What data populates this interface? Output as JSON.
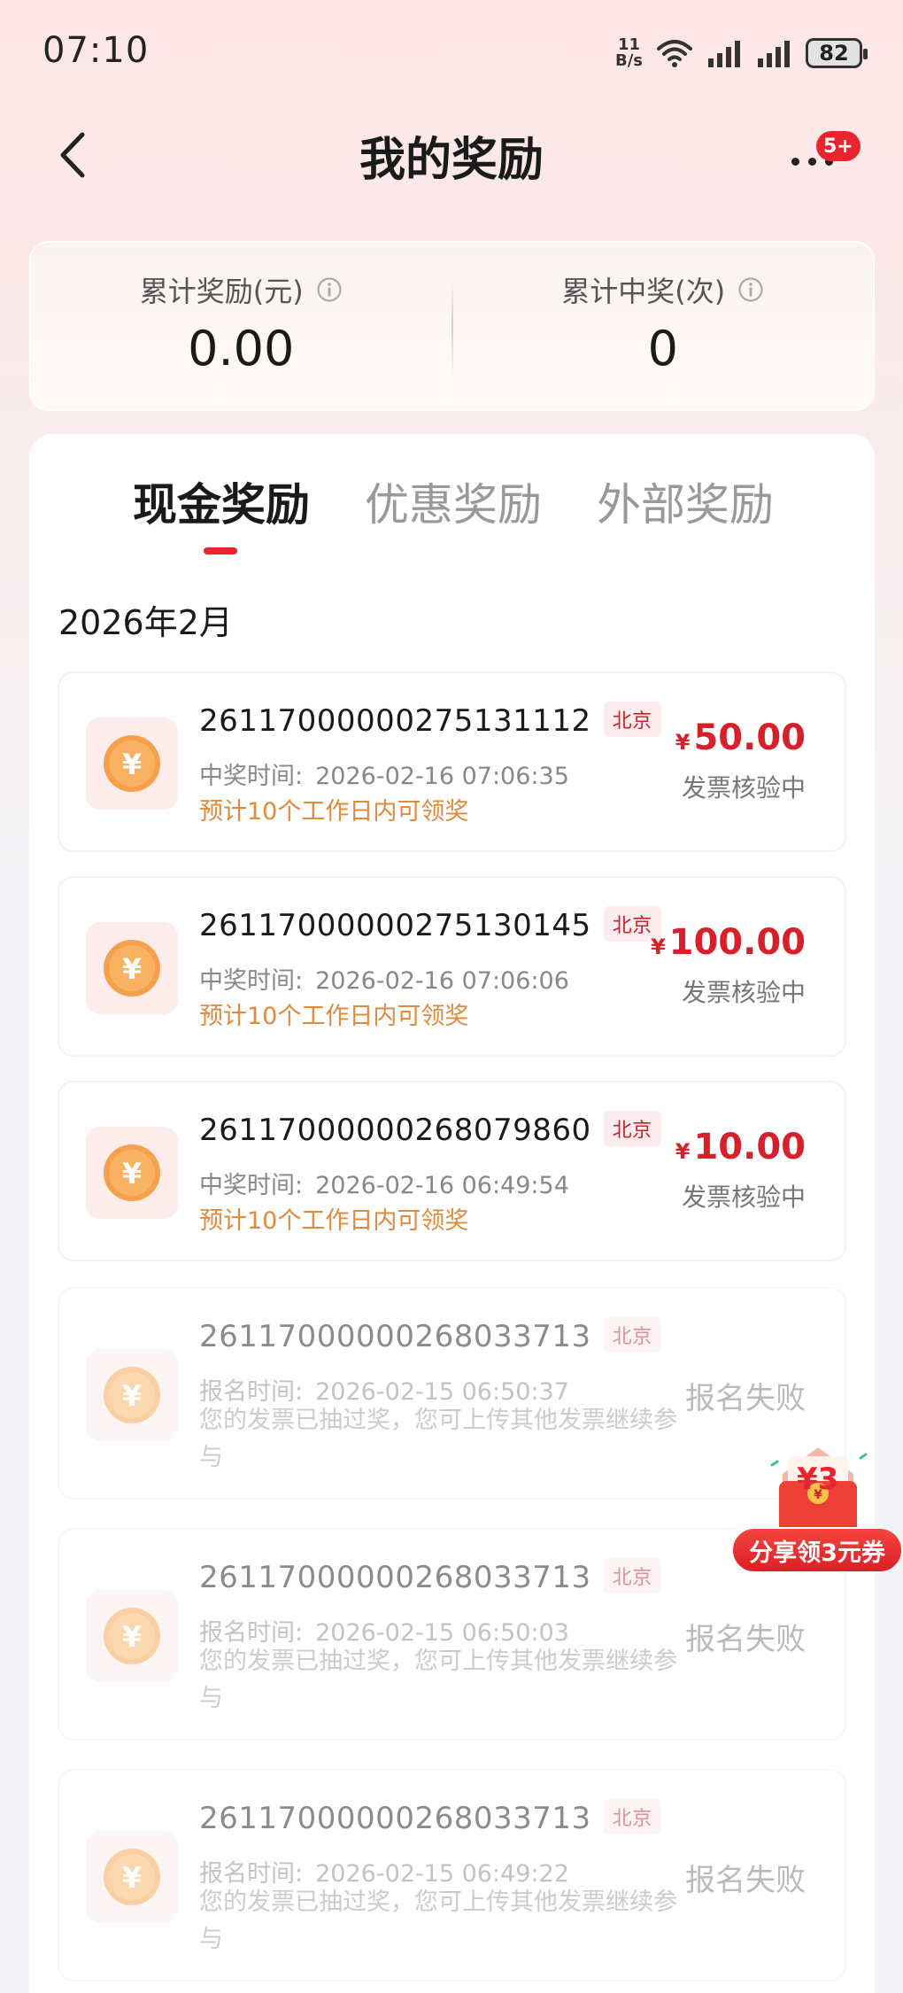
{
  "status_bar": {
    "time": "07:10",
    "net_speed_value": "11",
    "net_speed_unit": "B/s",
    "battery": "82"
  },
  "nav": {
    "title": "我的奖励",
    "more_badge": "5+"
  },
  "summary": {
    "total_reward_label": "累计奖励(元)",
    "total_reward_value": "0.00",
    "total_wins_label": "累计中奖(次)",
    "total_wins_value": "0"
  },
  "tabs": [
    {
      "label": "现金奖励",
      "active": true
    },
    {
      "label": "优惠奖励",
      "active": false
    },
    {
      "label": "外部奖励",
      "active": false
    }
  ],
  "month": "2026年2月",
  "records": [
    {
      "number": "26117000000275131112",
      "region": "北京",
      "time_label": "中奖时间:",
      "time": "2026-02-16 07:06:35",
      "note": "预计10个工作日内可领奖",
      "currency": "¥",
      "amount": "50.00",
      "status": "发票核验中"
    },
    {
      "number": "26117000000275130145",
      "region": "北京",
      "time_label": "中奖时间:",
      "time": "2026-02-16 07:06:06",
      "note": "预计10个工作日内可领奖",
      "currency": "¥",
      "amount": "100.00",
      "status": "发票核验中"
    },
    {
      "number": "26117000000268079860",
      "region": "北京",
      "time_label": "中奖时间:",
      "time": "2026-02-16 06:49:54",
      "note": "预计10个工作日内可领奖",
      "currency": "¥",
      "amount": "10.00",
      "status": "发票核验中"
    },
    {
      "number": "26117000000268033713",
      "region": "北京",
      "time_label": "报名时间:",
      "time": "2026-02-15 06:50:37",
      "note": "您的发票已抽过奖，您可上传其他发票继续参与",
      "status": "报名失败"
    },
    {
      "number": "26117000000268033713",
      "region": "北京",
      "time_label": "报名时间:",
      "time": "2026-02-15 06:50:03",
      "note": "您的发票已抽过奖，您可上传其他发票继续参与",
      "status": "报名失败"
    },
    {
      "number": "26117000000268033713",
      "region": "北京",
      "time_label": "报名时间:",
      "time": "2026-02-15 06:49:22",
      "note": "您的发票已抽过奖，您可上传其他发票继续参与",
      "status": "报名失败"
    }
  ],
  "coupon": {
    "amount_badge": "¥3",
    "button_label": "分享领3元券"
  },
  "colors": {
    "accent_red": "#e8242f",
    "amount_red": "#d8202a",
    "note_orange": "#e08a3c"
  }
}
